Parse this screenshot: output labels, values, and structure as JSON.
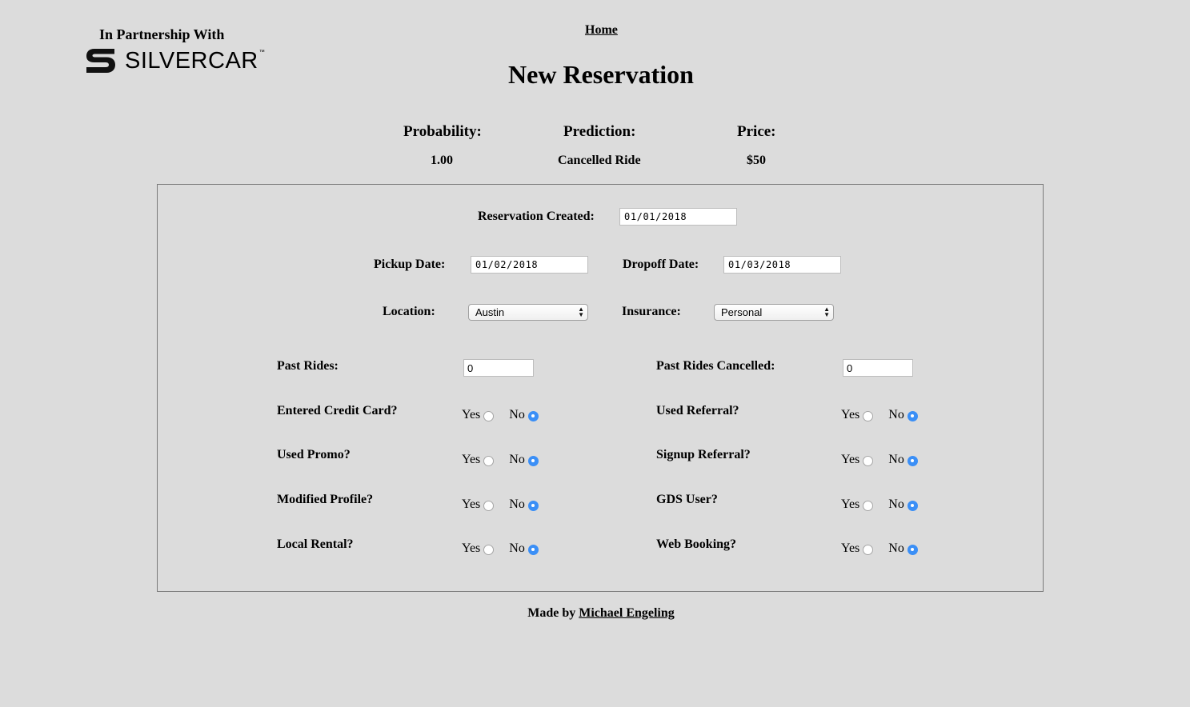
{
  "branding": {
    "partner_text": "In Partnership With",
    "logo_text": "SILVERCAR",
    "logo_tm": "™"
  },
  "nav": {
    "home": "Home"
  },
  "page_title": "New Reservation",
  "stats": {
    "probability": {
      "label": "Probability:",
      "value": "1.00"
    },
    "prediction": {
      "label": "Prediction:",
      "value": "Cancelled Ride"
    },
    "price": {
      "label": "Price:",
      "value": "$50"
    }
  },
  "form": {
    "reservation_created": {
      "label": "Reservation Created:",
      "value": "01/01/2018"
    },
    "pickup_date": {
      "label": "Pickup Date:",
      "value": "01/02/2018"
    },
    "dropoff_date": {
      "label": "Dropoff Date:",
      "value": "01/03/2018"
    },
    "location": {
      "label": "Location:",
      "value": "Austin"
    },
    "insurance": {
      "label": "Insurance:",
      "value": "Personal"
    },
    "past_rides": {
      "label": "Past Rides:",
      "value": "0"
    },
    "past_rides_cancelled": {
      "label": "Past Rides Cancelled:",
      "value": "0"
    },
    "yes_label": "Yes",
    "no_label": "No",
    "questions": {
      "entered_credit_card": {
        "label": "Entered Credit Card?",
        "selected": "No"
      },
      "used_referral": {
        "label": "Used Referral?",
        "selected": "No"
      },
      "used_promo": {
        "label": "Used Promo?",
        "selected": "No"
      },
      "signup_referral": {
        "label": "Signup Referral?",
        "selected": "No"
      },
      "modified_profile": {
        "label": "Modified Profile?",
        "selected": "No"
      },
      "gds_user": {
        "label": "GDS User?",
        "selected": "No"
      },
      "local_rental": {
        "label": "Local Rental?",
        "selected": "No"
      },
      "web_booking": {
        "label": "Web Booking?",
        "selected": "No"
      }
    }
  },
  "footer": {
    "prefix": "Made by",
    "author": "Michael Engeling"
  },
  "colors": {
    "background": "#dcdcdc",
    "radio_checked": "#3b8ff6",
    "panel_border": "#7a7a7a"
  }
}
